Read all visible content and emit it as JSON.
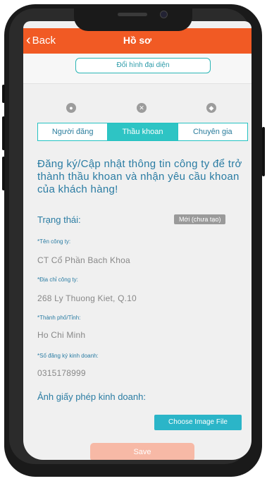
{
  "header": {
    "back_label": "Back",
    "title": "Hồ sơ"
  },
  "avatar": {
    "change_label": "Đổi hình đại diện"
  },
  "tabs": [
    {
      "label": "Người đăng",
      "icon": "person-icon"
    },
    {
      "label": "Thầu khoan",
      "icon": "drill-icon"
    },
    {
      "label": "Chuyên gia",
      "icon": "expert-icon"
    }
  ],
  "intro": "Đăng ký/Cập nhật thông tin công ty để trở thành thầu khoan và nhận yêu cầu khoan của khách hàng!",
  "status": {
    "label": "Trạng thái:",
    "value": "Mới (chưa tạo)"
  },
  "fields": [
    {
      "label": "*Tên công ty:",
      "value": "CT Cổ Phần Bach Khoa"
    },
    {
      "label": "*Địa chỉ công ty:",
      "value": "268 Ly Thuong Kiet, Q.10"
    },
    {
      "label": "*Thành phố/Tỉnh:",
      "value": "Ho Chi Minh"
    },
    {
      "label": "*Số đăng ký kinh doanh:",
      "value": "0315178999"
    }
  ],
  "license": {
    "label": "Ảnh giấy phép kinh doanh:",
    "choose_label": "Choose Image File"
  },
  "save_label": "Save",
  "colors": {
    "header": "#f15a24",
    "accent": "#2ec4c4",
    "text": "#2a7ca3",
    "save_disabled": "#f7b9a6"
  }
}
